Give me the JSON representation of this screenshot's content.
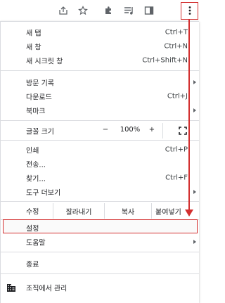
{
  "toolbar": {
    "icons": [
      "share-icon",
      "bookmark-star-icon",
      "extensions-icon",
      "reading-list-icon",
      "side-panel-icon",
      "kebab-menu-icon"
    ]
  },
  "menu": {
    "new_tab": {
      "label": "새 탭",
      "shortcut": "Ctrl+T"
    },
    "new_window": {
      "label": "새 창",
      "shortcut": "Ctrl+N"
    },
    "incognito": {
      "label": "새 시크릿 창",
      "shortcut": "Ctrl+Shift+N"
    },
    "history": {
      "label": "방문 기록"
    },
    "downloads": {
      "label": "다운로드",
      "shortcut": "Ctrl+J"
    },
    "bookmarks": {
      "label": "북마크"
    },
    "zoom": {
      "label": "글꼴 크기",
      "minus": "−",
      "value": "100%",
      "plus": "+"
    },
    "print": {
      "label": "인쇄",
      "shortcut": "Ctrl+P"
    },
    "cast": {
      "label": "전송..."
    },
    "find": {
      "label": "찾기...",
      "shortcut": "Ctrl+F"
    },
    "more_tools": {
      "label": "도구 더보기"
    },
    "edit": {
      "label": "수정",
      "cut": "잘라내기",
      "copy": "복사",
      "paste": "붙여넣기"
    },
    "settings": {
      "label": "설정"
    },
    "help": {
      "label": "도움말"
    },
    "exit": {
      "label": "종료"
    },
    "managed": {
      "label": "조직에서 관리"
    }
  },
  "colors": {
    "annotation": "#d32f2f",
    "separator": "#dadce0",
    "text": "#202124"
  }
}
